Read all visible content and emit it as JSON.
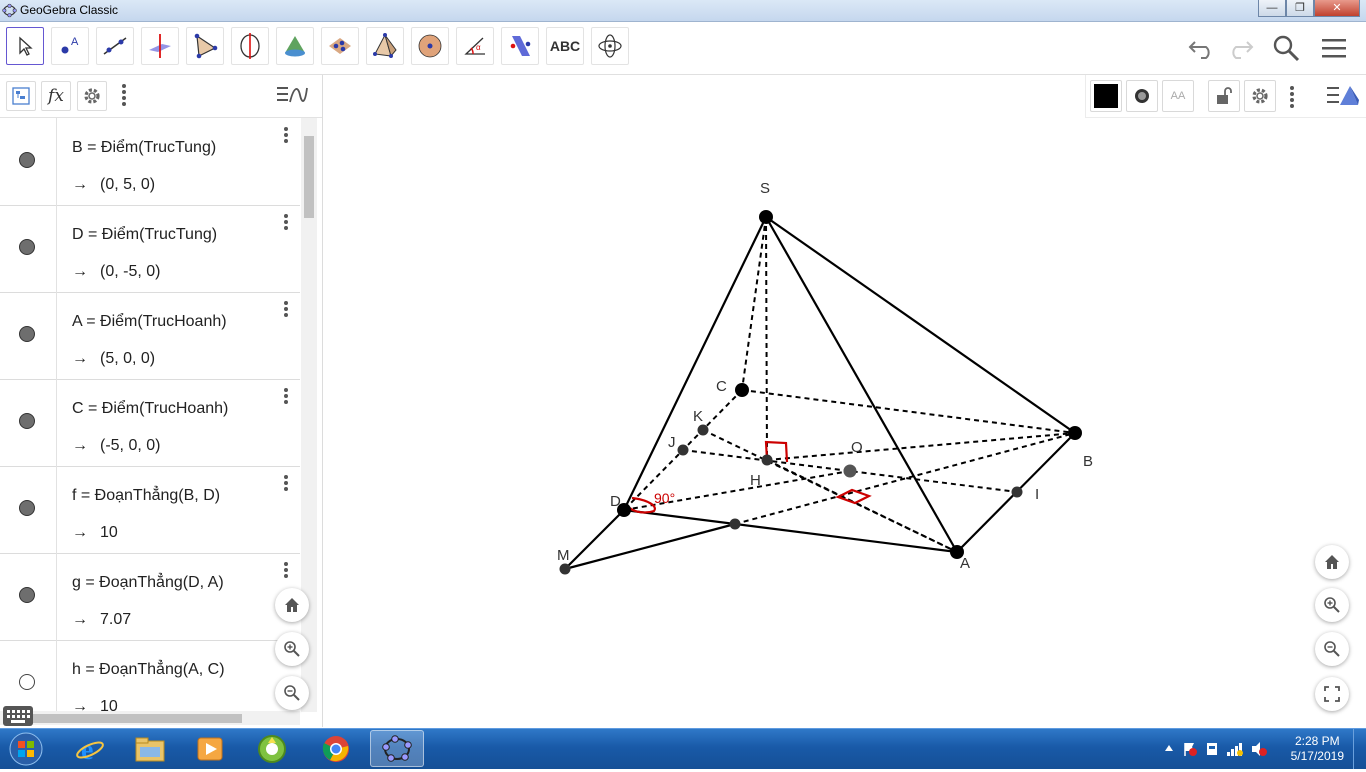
{
  "window": {
    "title": "GeoGebra Classic",
    "minimize": "—",
    "maximize": "❐",
    "close": "✕"
  },
  "toolbar": {
    "text_tool_label": "ABC"
  },
  "algebra": {
    "rows": [
      {
        "def": "B = Điểm(TrucTung)",
        "value": "(0, 5, 0)",
        "visible": true
      },
      {
        "def": "D = Điểm(TrucTung)",
        "value": "(0, -5, 0)",
        "visible": true
      },
      {
        "def": "A = Điểm(TrucHoanh)",
        "value": "(5, 0, 0)",
        "visible": true
      },
      {
        "def": "C = Điểm(TrucHoanh)",
        "value": "(-5, 0, 0)",
        "visible": true
      },
      {
        "def": "f = ĐoạnThẳng(B, D)",
        "value": "10",
        "visible": true
      },
      {
        "def": "g = ĐoạnThẳng(D, A)",
        "value": "7.07",
        "visible": true
      },
      {
        "def": "h = ĐoạnThẳng(A, C)",
        "value": "10",
        "visible": false
      }
    ],
    "arrow": "→"
  },
  "graphics": {
    "points": {
      "S": "S",
      "C": "C",
      "K": "K",
      "J": "J",
      "H": "H",
      "O": "O",
      "B": "B",
      "I": "I",
      "D": "D",
      "A": "A",
      "M": "M"
    },
    "angle_label": "90°",
    "colors": {
      "angle": "#cc0000",
      "point": "#000000",
      "line": "#000000"
    }
  },
  "taskbar": {
    "time": "2:28 PM",
    "date": "5/17/2019"
  }
}
